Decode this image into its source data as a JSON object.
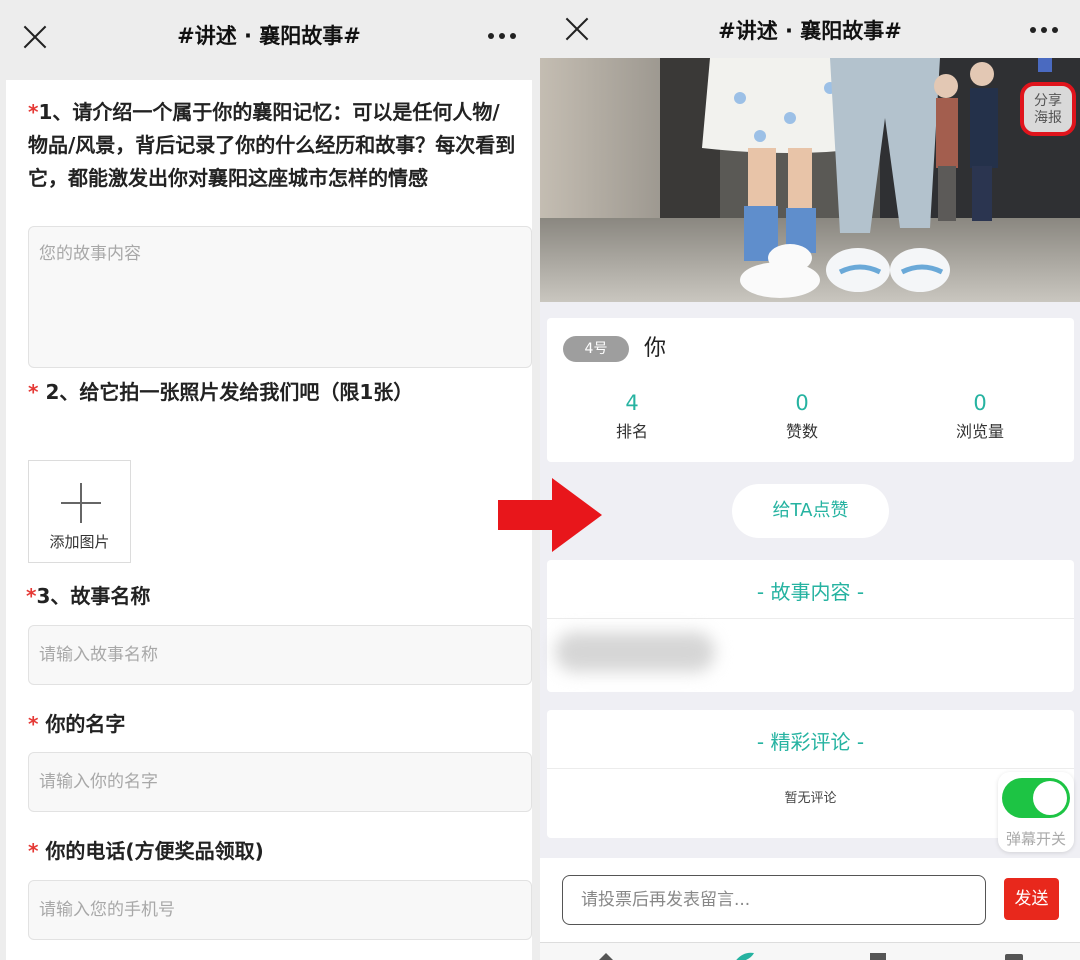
{
  "left": {
    "header": {
      "title": "#讲述 · 襄阳故事#"
    },
    "form": {
      "q1": {
        "required_mark": "*",
        "label": "1、请介绍一个属于你的襄阳记忆：可以是任何人物/物品/风景，背后记录了你的什么经历和故事？每次看到它，都能激发出你对襄阳这座城市怎样的情感"
      },
      "story_content": {
        "placeholder": "您的故事内容"
      },
      "q2": {
        "required_mark": "*",
        "label": "2、给它拍一张照片发给我们吧（限1张）"
      },
      "upload": {
        "label": "添加图片"
      },
      "q3": {
        "required_mark": "*",
        "label": "3、故事名称"
      },
      "story_name": {
        "placeholder": "请输入故事名称"
      },
      "name_q": {
        "required_mark": "*",
        "label": "你的名字"
      },
      "name_input": {
        "placeholder": "请输入你的名字"
      },
      "phone_q": {
        "required_mark": "*",
        "label": "你的电话(方便奖品领取)"
      },
      "phone_input": {
        "placeholder": "请输入您的手机号"
      }
    }
  },
  "arrow_color": "#e8161b",
  "right": {
    "header": {
      "title": "#讲述 · 襄阳故事#"
    },
    "share": {
      "line1": "分享",
      "line2": "海报"
    },
    "profile": {
      "badge": "4号",
      "name": "你",
      "stats": [
        {
          "value": "4",
          "label": "排名"
        },
        {
          "value": "0",
          "label": "赞数"
        },
        {
          "value": "0",
          "label": "浏览量"
        }
      ]
    },
    "like_button": "给TA点赞",
    "story_section": {
      "title": "-  故事内容  -"
    },
    "comments_section": {
      "title": "-  精彩评论  -",
      "empty": "暂无评论"
    },
    "danmaku": {
      "label": "弹幕开关",
      "on": true
    },
    "message": {
      "placeholder": "请投票后再发表留言...",
      "send": "发送"
    },
    "accent_color": "#26b3a1"
  }
}
